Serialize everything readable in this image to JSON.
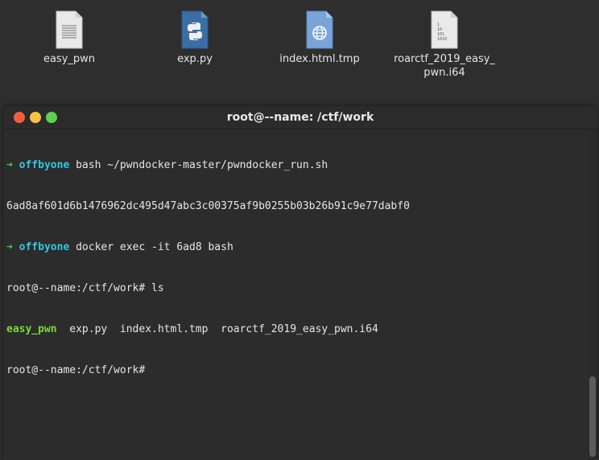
{
  "desktop": {
    "files": [
      {
        "name": "easy_pwn",
        "icon": "text-file-icon"
      },
      {
        "name": "exp.py",
        "icon": "python-file-icon"
      },
      {
        "name": "index.html.tmp",
        "icon": "html-file-icon"
      },
      {
        "name": "roarctf_2019_easy_\npwn.i64",
        "icon": "binary-file-icon"
      }
    ]
  },
  "terminal": {
    "title": "root@--name: /ctf/work",
    "lines": {
      "l1_arrow": "➜",
      "l1_user": "offbyone",
      "l1_cmd": " bash ~/pwndocker-master/pwndocker_run.sh",
      "l2": "6ad8af601d6b1476962dc495d47abc3c00375af9b0255b03b26b91c9e77dabf0",
      "l3_arrow": "➜",
      "l3_user": "offbyone",
      "l3_cmd": " docker exec -it 6ad8 bash",
      "l4": "root@--name:/ctf/work# ls",
      "l5_exec": "easy_pwn",
      "l5_rest": "  exp.py  index.html.tmp  roarctf_2019_easy_pwn.i64",
      "l6": "root@--name:/ctf/work#"
    }
  },
  "colors": {
    "prompt_arrow": "#3ed13e",
    "prompt_user": "#35c6e0",
    "executable": "#7bd63b"
  }
}
